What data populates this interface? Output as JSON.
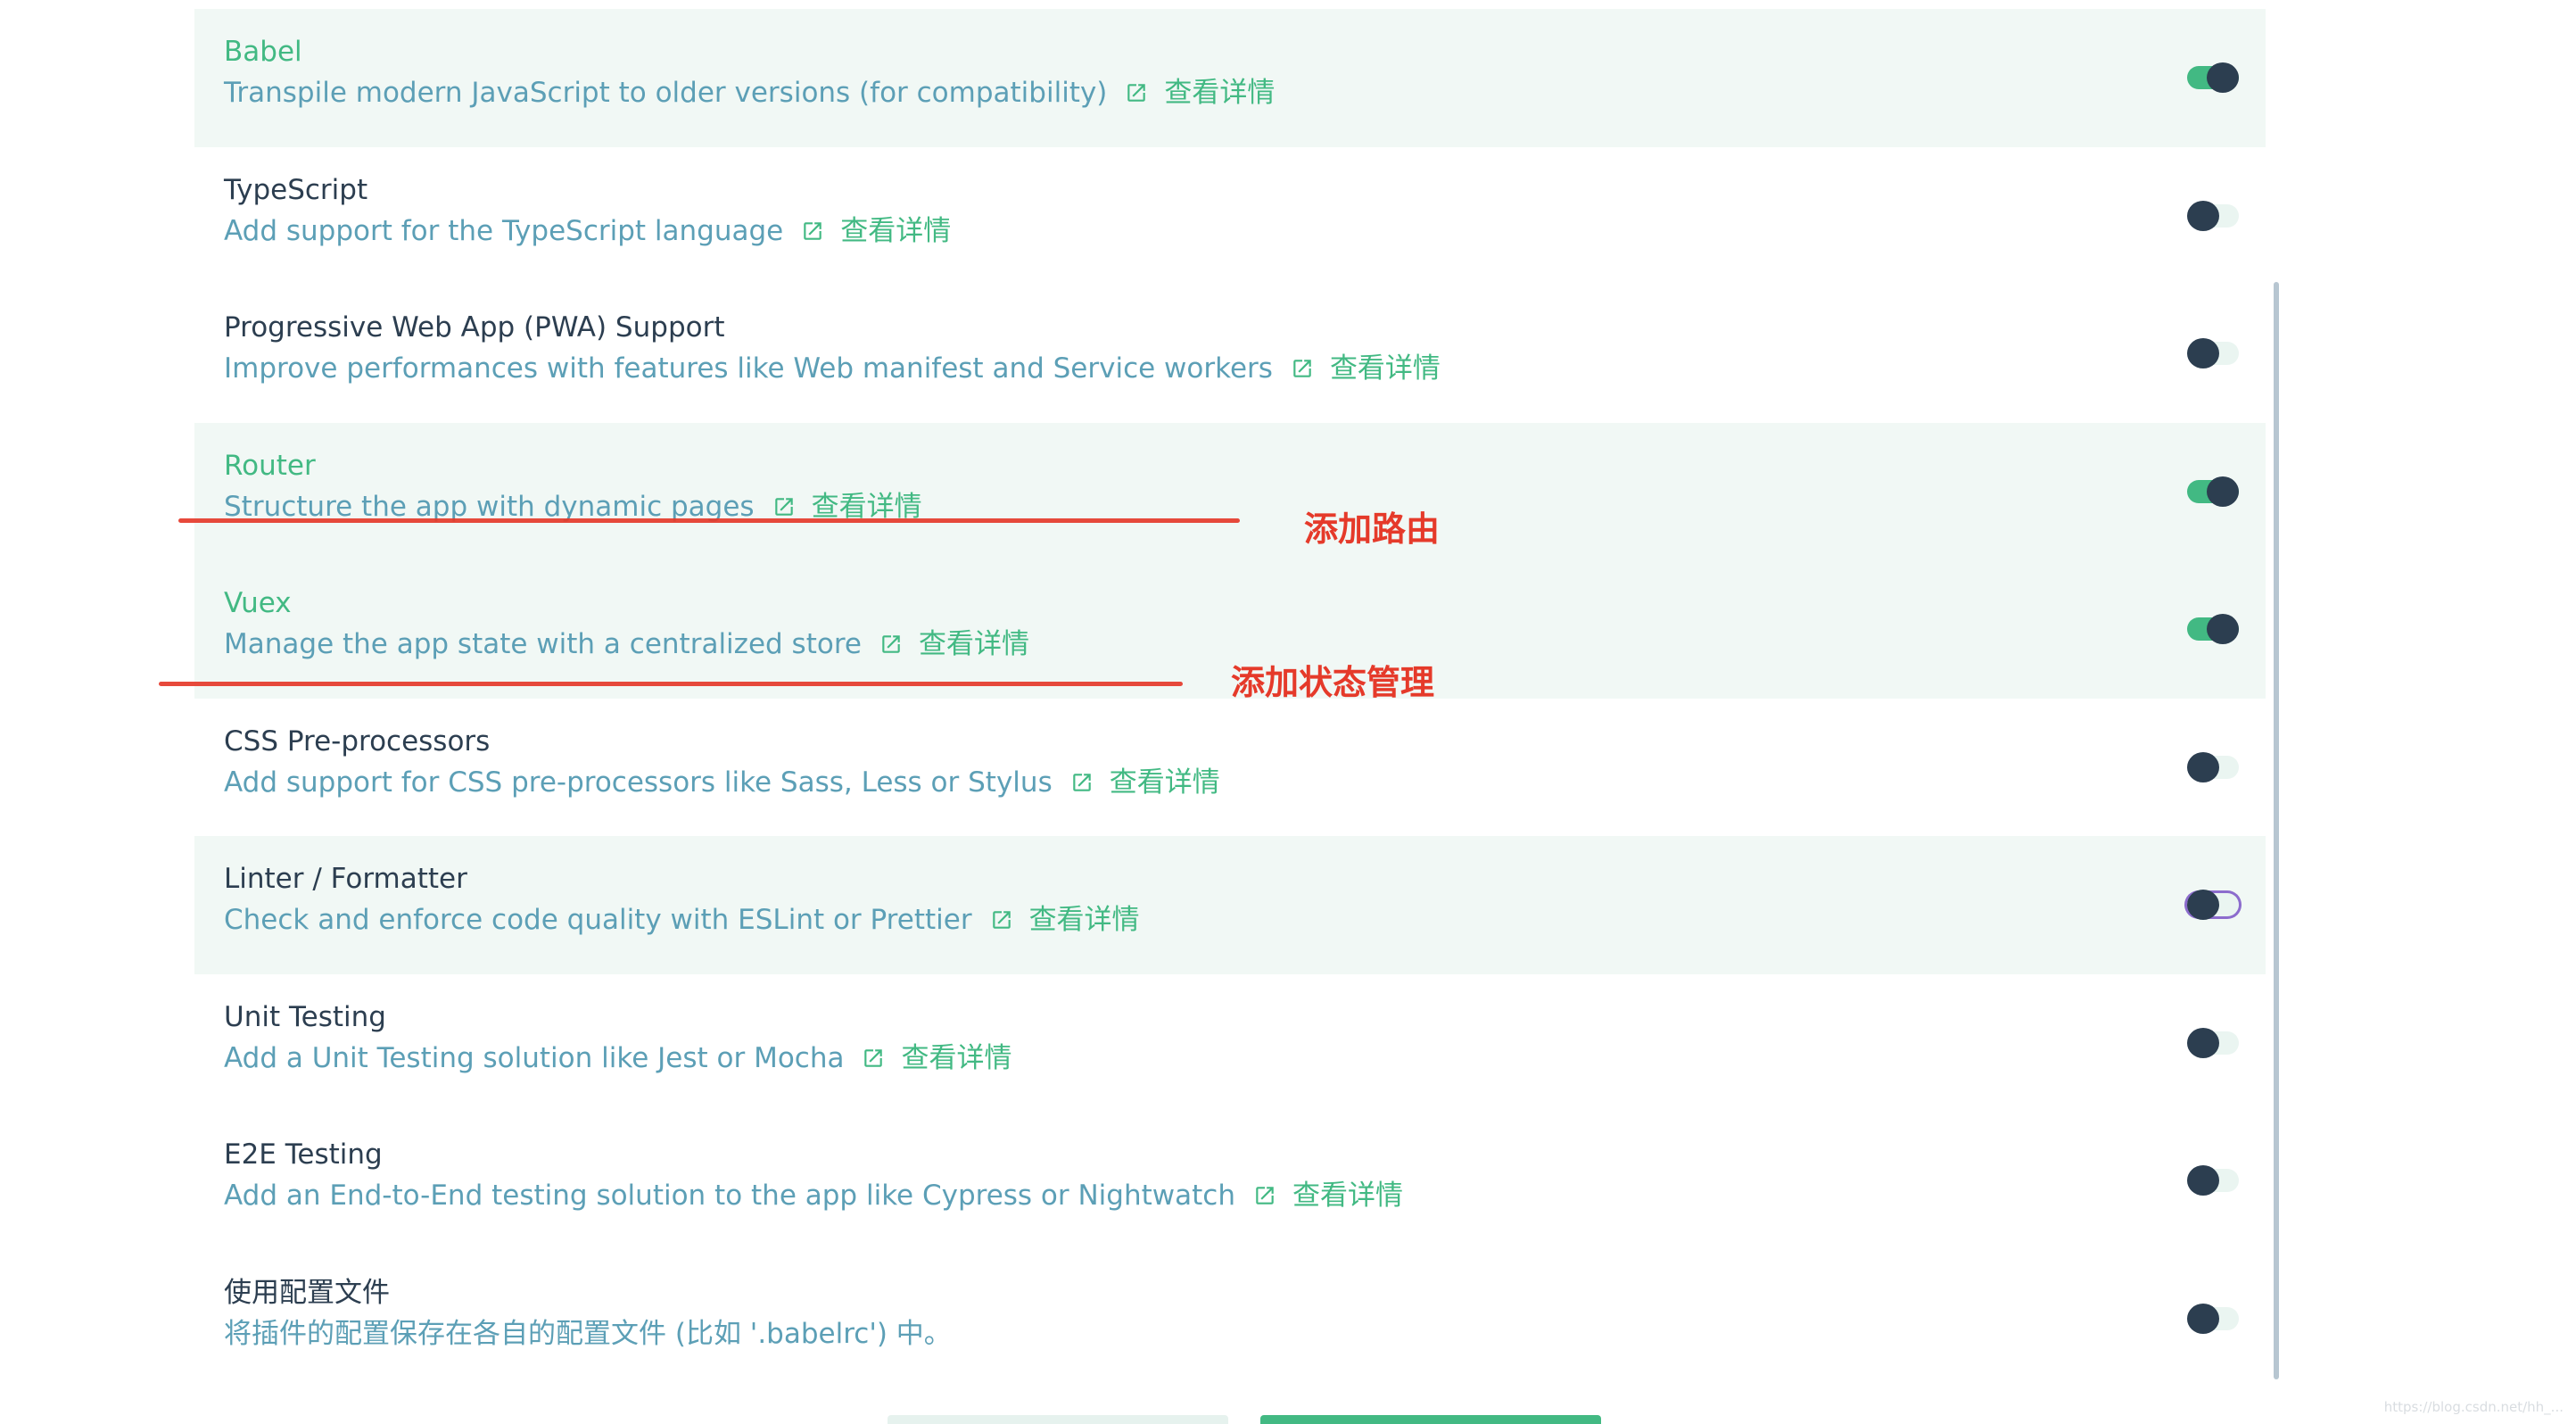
{
  "features": [
    {
      "name": "Babel",
      "description": "Transpile modern JavaScript to older versions (for compatibility)",
      "more_label": "查看详情",
      "enabled": true
    },
    {
      "name": "TypeScript",
      "description": "Add support for the TypeScript language",
      "more_label": "查看详情",
      "enabled": false
    },
    {
      "name": "Progressive Web App (PWA) Support",
      "description": "Improve performances with features like Web manifest and Service workers",
      "more_label": "查看详情",
      "enabled": false
    },
    {
      "name": "Router",
      "description": "Structure the app with dynamic pages",
      "more_label": "查看详情",
      "enabled": true
    },
    {
      "name": "Vuex",
      "description": "Manage the app state with a centralized store",
      "more_label": "查看详情",
      "enabled": true
    },
    {
      "name": "CSS Pre-processors",
      "description": "Add support for CSS pre-processors like Sass, Less or Stylus",
      "more_label": "查看详情",
      "enabled": false
    },
    {
      "name": "Linter / Formatter",
      "description": "Check and enforce code quality with ESLint or Prettier",
      "more_label": "查看详情",
      "enabled": false
    },
    {
      "name": "Unit Testing",
      "description": "Add a Unit Testing solution like Jest or Mocha",
      "more_label": "查看详情",
      "enabled": false
    },
    {
      "name": "E2E Testing",
      "description": "Add an End-to-End testing solution to the app like Cypress or Nightwatch",
      "more_label": "查看详情",
      "enabled": false
    },
    {
      "name": "使用配置文件",
      "description": "将插件的配置保存在各自的配置文件 (比如 '.babelrc') 中。",
      "more_label": "",
      "enabled": false
    }
  ],
  "annotations": {
    "router": "添加路由",
    "vuex": "添加状态管理"
  },
  "watermark": "https://blog.csdn.net/hh_..."
}
